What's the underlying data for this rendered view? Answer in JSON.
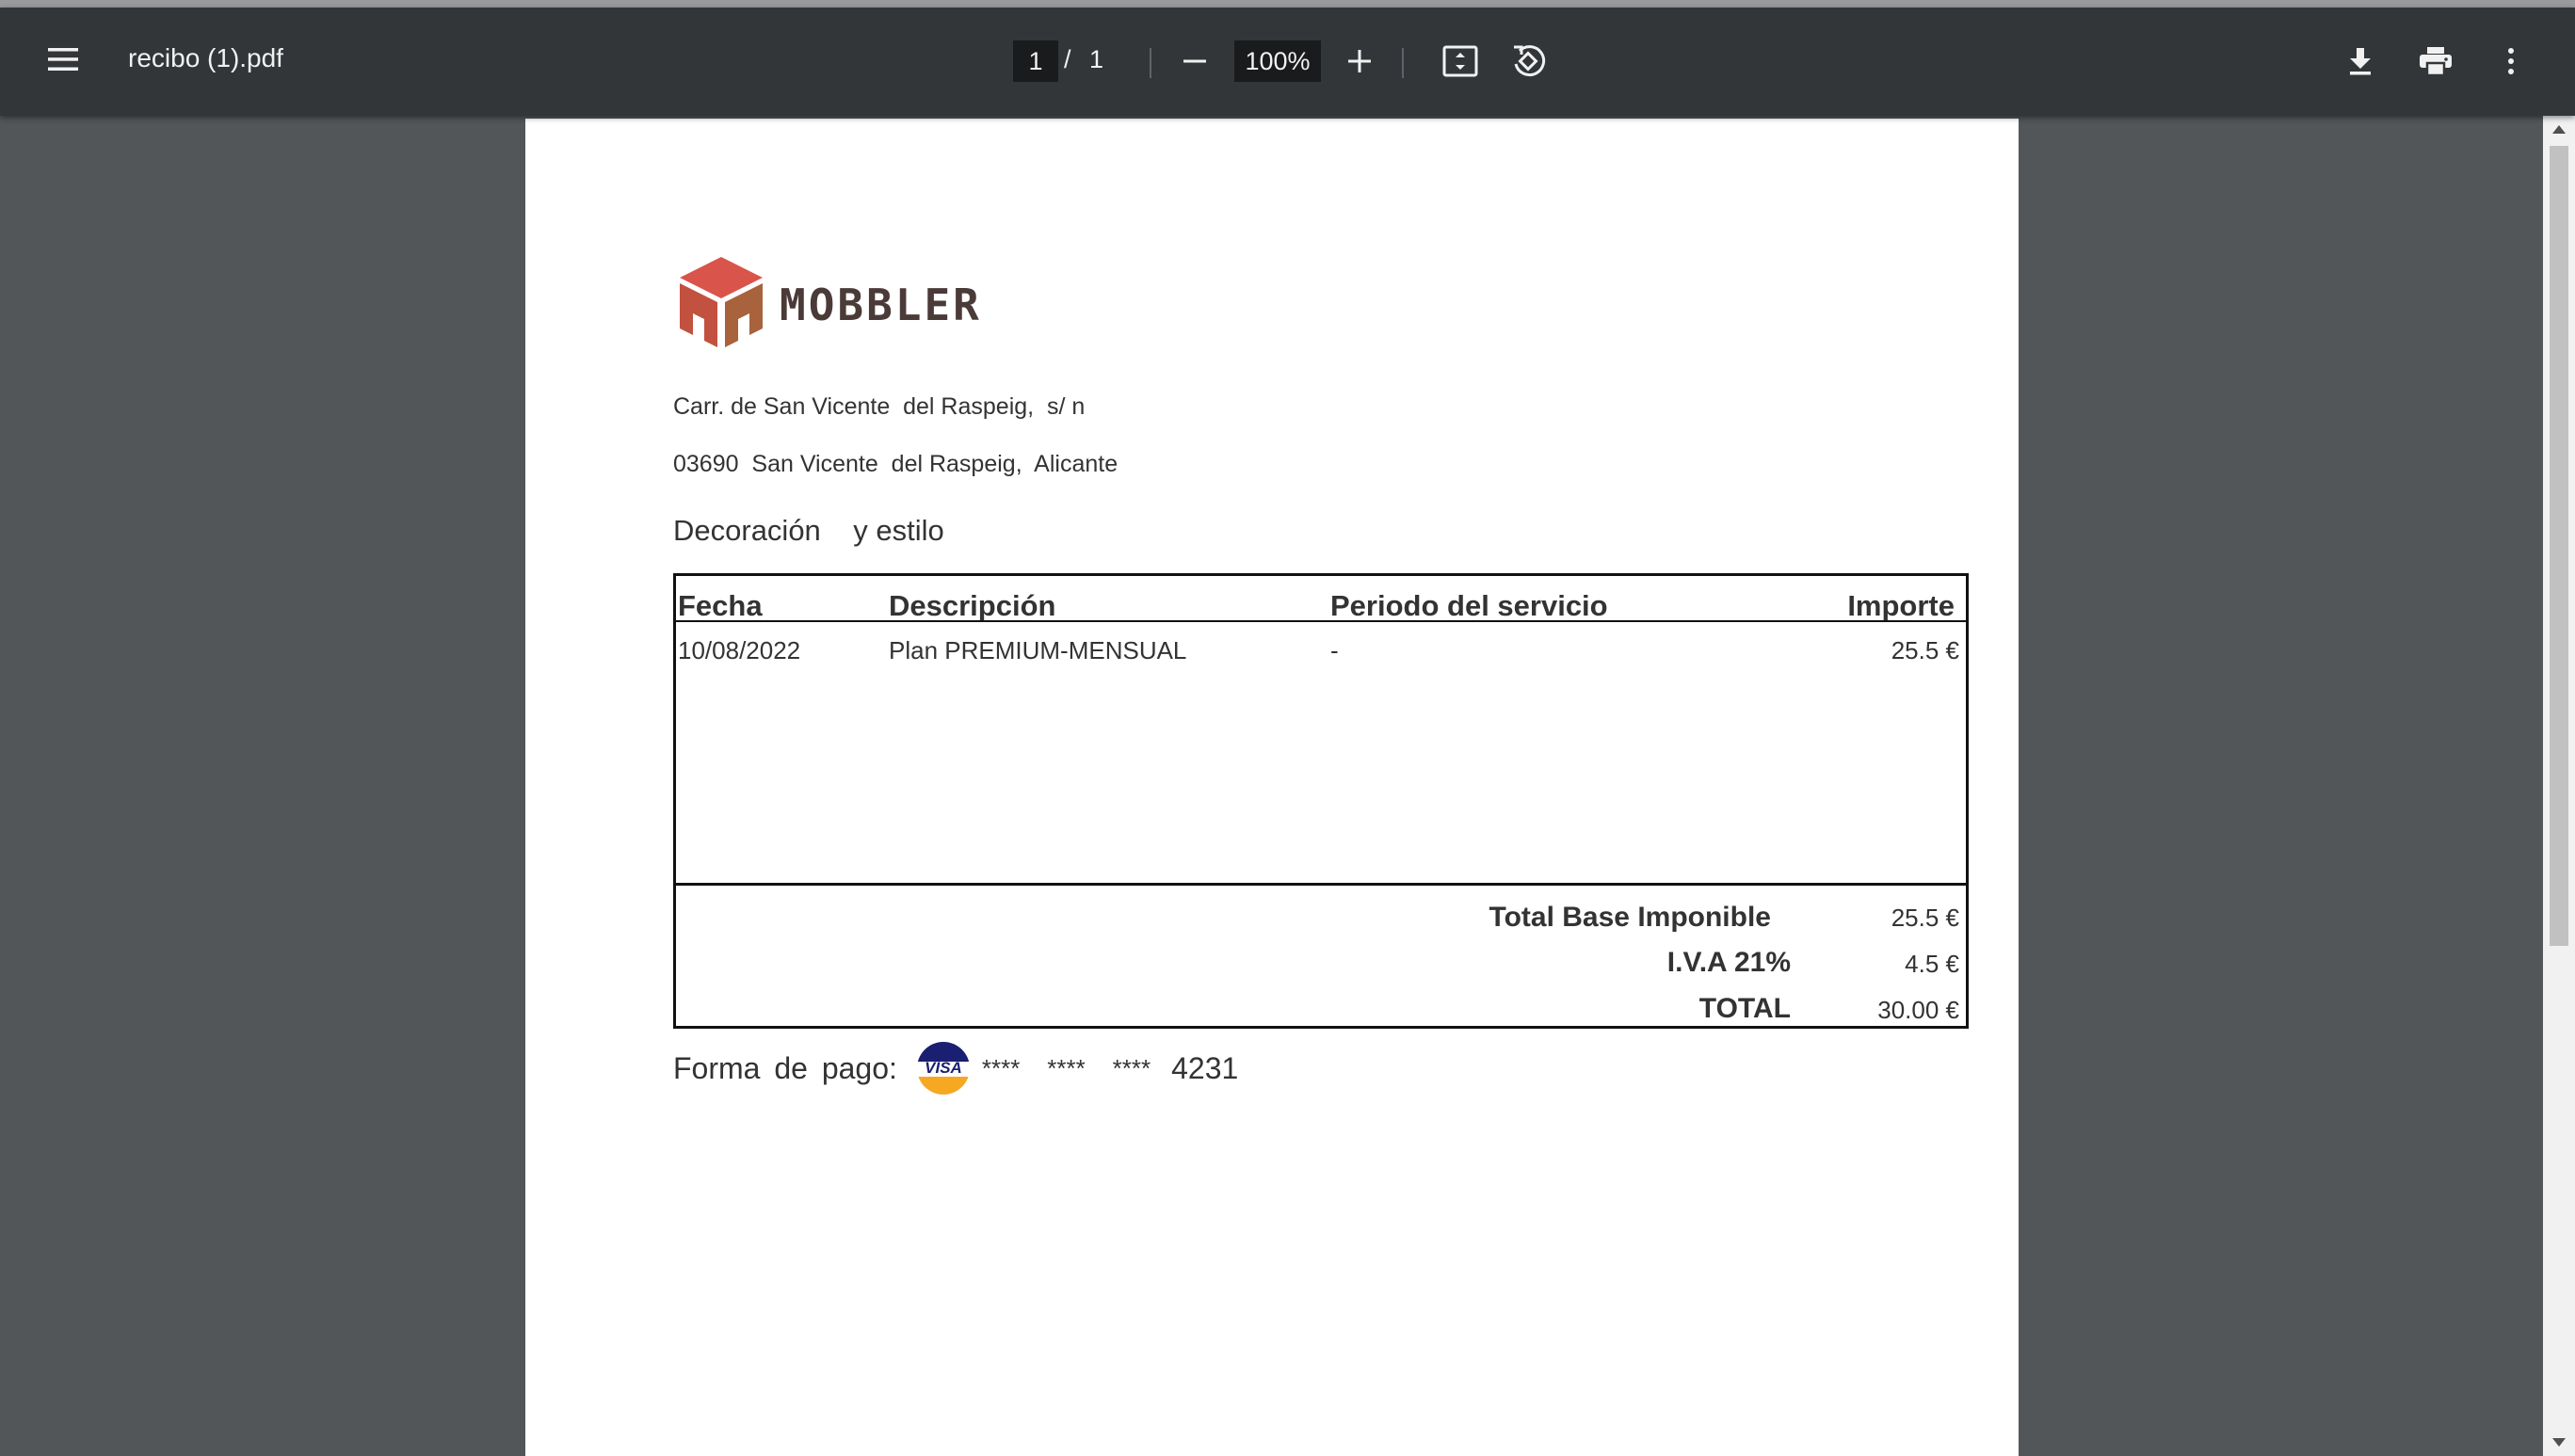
{
  "toolbar": {
    "file_name": "recibo (1).pdf",
    "current_page": "1",
    "page_separator": "/",
    "total_pages": "1",
    "zoom": "100%",
    "icons": {
      "menu": "hamburger-menu-icon",
      "zoom_out": "minus-icon",
      "zoom_in": "plus-icon",
      "fit": "fit-to-page-icon",
      "rotate": "rotate-counterclockwise-icon",
      "download": "download-icon",
      "print": "print-icon",
      "more": "more-vertical-icon"
    }
  },
  "document": {
    "logo_text": "MOBBLER",
    "address_line1": "Carr. de San Vicente  del Raspeig,  s/ n",
    "address_line2": "03690  San Vicente  del Raspeig,  Alicante",
    "tagline": "Decoración    y estilo",
    "table": {
      "headers": {
        "date": "Fecha",
        "description": "Descripción",
        "period": "Periodo del servicio",
        "amount": "Importe"
      },
      "rows": [
        {
          "date": "10/08/2022",
          "description": "Plan  PREMIUM-MENSUAL",
          "period": "-",
          "amount": "25.5 €"
        }
      ],
      "totals": {
        "base_label": "Total  Base Imponible",
        "base_value": "25.5 €",
        "vat_label": "I.V.A 21%",
        "vat_value": "4.5 €",
        "total_label": "TOTAL",
        "total_value": "30.00 €"
      }
    },
    "payment": {
      "label": "Forma  de  pago:",
      "card_brand": "VISA",
      "masked": "****    ****    ****",
      "last4": "4231"
    }
  },
  "colors": {
    "toolbar_bg": "#323639",
    "viewer_bg": "#525659",
    "logo_red": "#d9544a",
    "logo_brown": "#a8623c",
    "logo_text": "#4a3a38",
    "visa_blue": "#1a1f71",
    "visa_orange": "#f7a823"
  }
}
